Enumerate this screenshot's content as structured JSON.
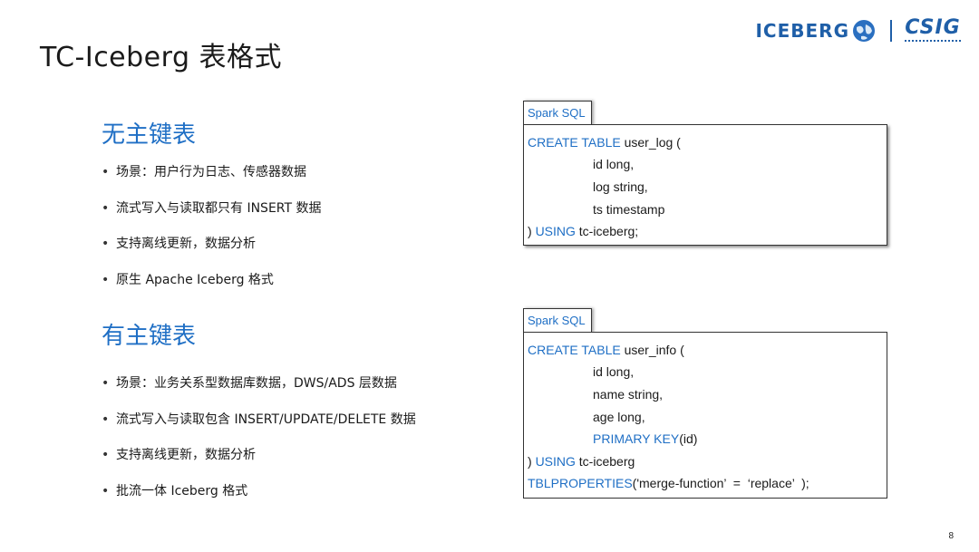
{
  "title": "TC-Iceberg 表格式",
  "logos": {
    "iceberg": "ICEBERG",
    "csig": "CSIG"
  },
  "section1": {
    "heading": "无主键表",
    "bullets": [
      "场景：用户行为日志、传感器数据",
      "流式写入与读取都只有 INSERT 数据",
      "支持离线更新，数据分析",
      "原生 Apache Iceberg 格式"
    ]
  },
  "section2": {
    "heading": "有主键表",
    "bullets": [
      "场景：业务关系型数据库数据，DWS/ADS 层数据",
      "流式写入与读取包含 INSERT/UPDATE/DELETE 数据",
      "支持离线更新，数据分析",
      "批流一体 Iceberg 格式"
    ]
  },
  "code1": {
    "tab": "Spark SQL",
    "l1_kw": "CREATE TABLE",
    "l1_rest": " user_log (",
    "l2": "id long,",
    "l3": "log string,",
    "l4": "ts timestamp",
    "l5_pre": ") ",
    "l5_kw": "USING",
    "l5_rest": " tc-iceberg;"
  },
  "code2": {
    "tab": "Spark SQL",
    "l1_kw": "CREATE TABLE",
    "l1_rest": " user_info (",
    "l2": "id long,",
    "l3": "name string,",
    "l4": "age long,",
    "l5_kw": "PRIMARY KEY",
    "l5_rest": "(id)",
    "l6_pre": ") ",
    "l6_kw": "USING",
    "l6_rest": " tc-iceberg",
    "l7_kw": "TBLPROPERTIES",
    "l7_rest": "('merge-function’  =  ‘replace’  );"
  },
  "page_number": "8",
  "colors": {
    "accent": "#1f6fc5",
    "logo": "#1f5fa8"
  }
}
